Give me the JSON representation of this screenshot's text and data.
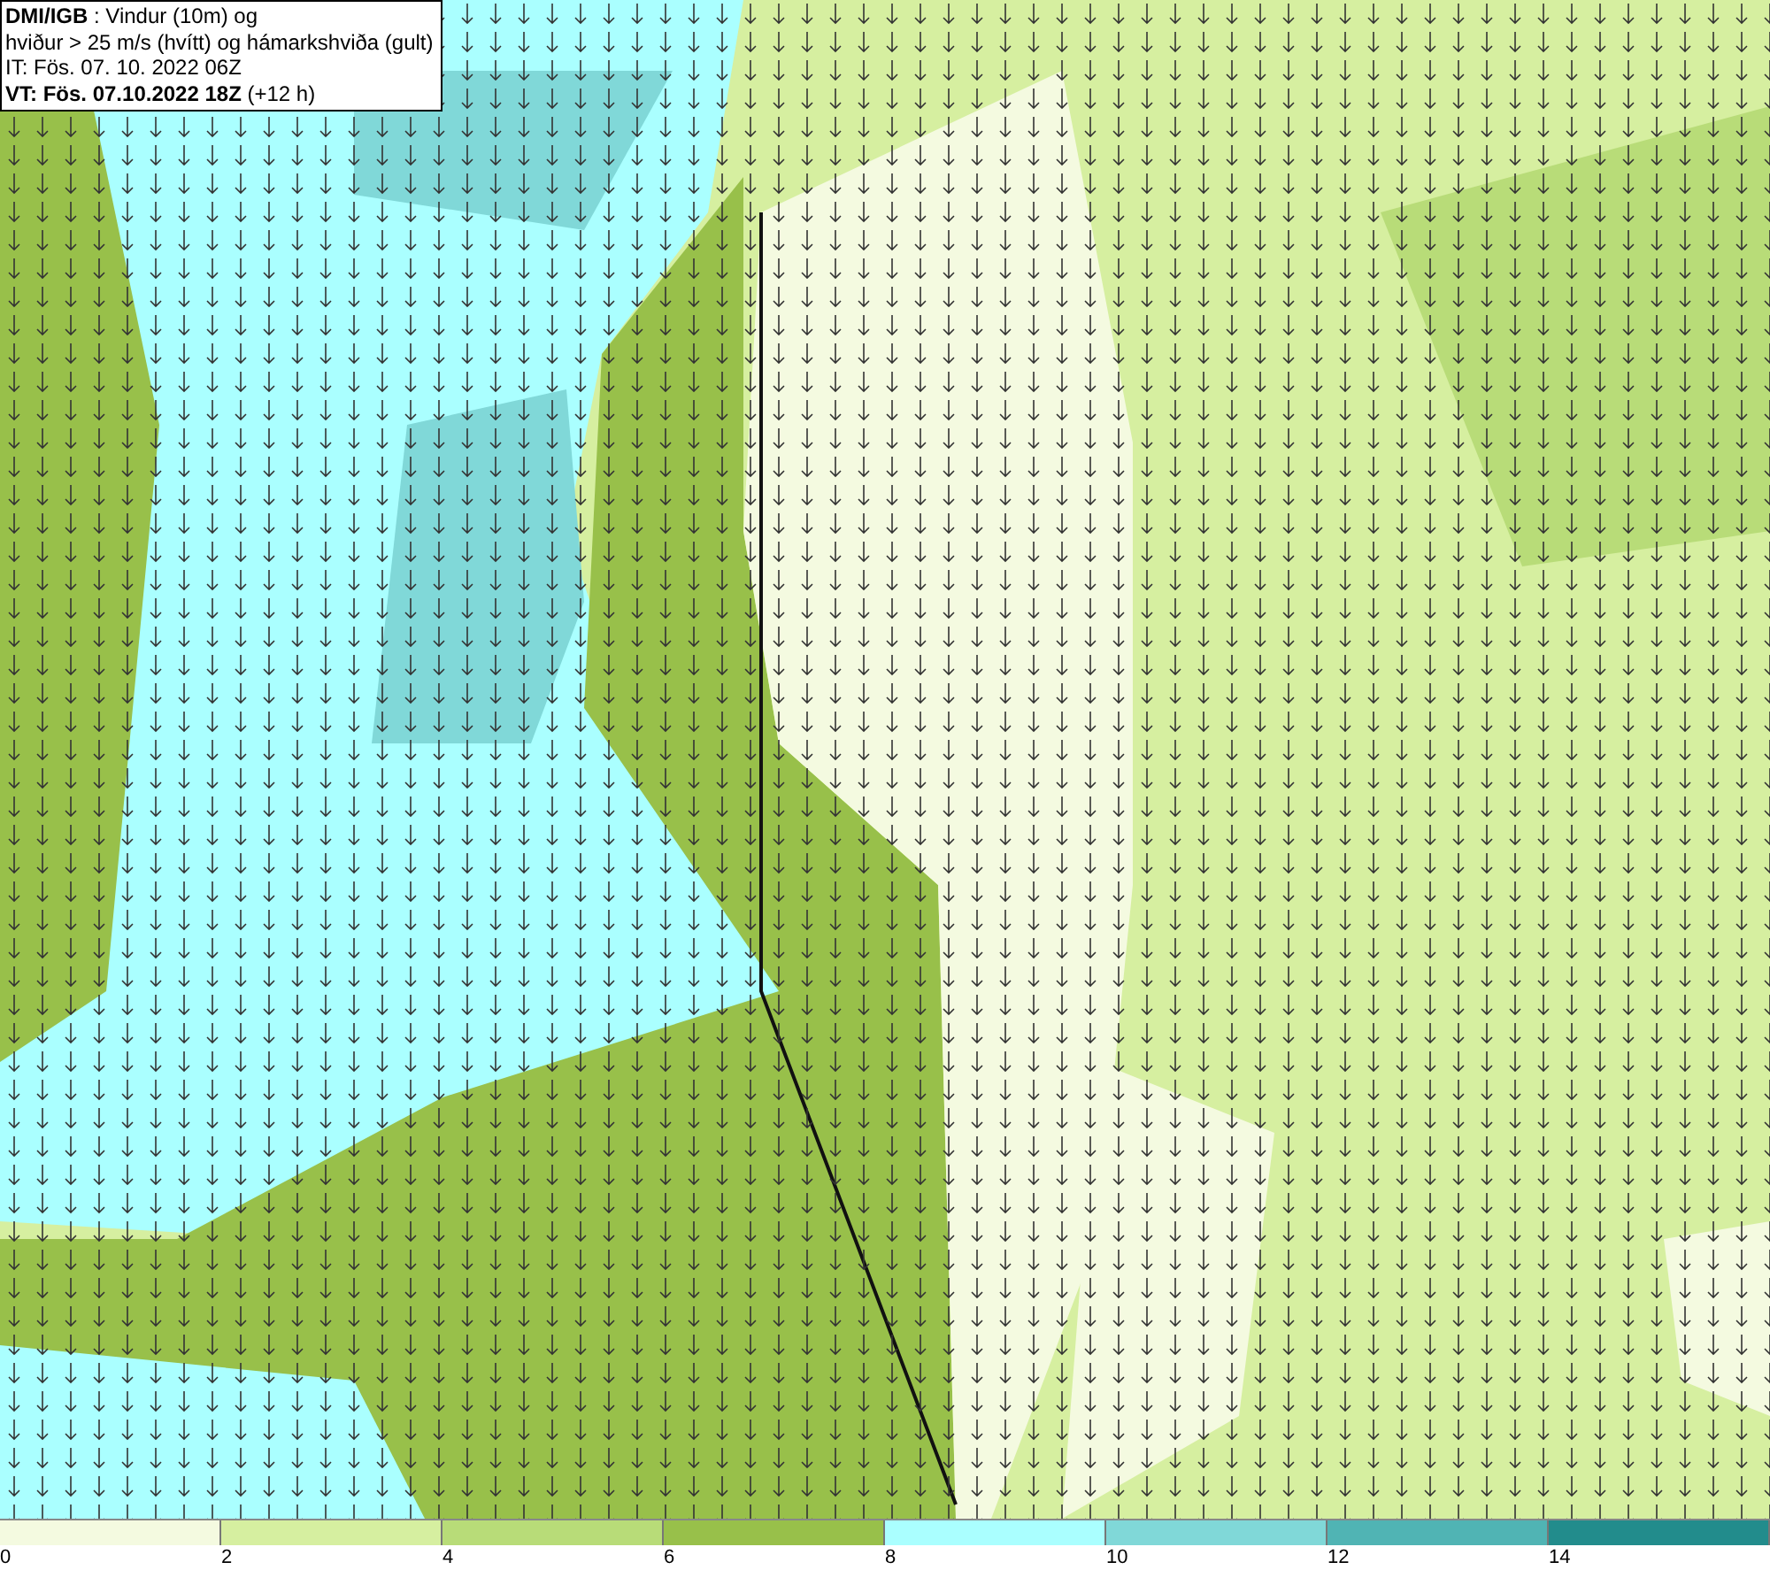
{
  "title_box": {
    "lines": [
      "**DMI/IGB** : Vindur (10m) og",
      "hviður > 25 m/s (hvítt) og hámarkshviða (gult)",
      "IT: Fös. 07. 10. 2022 06Z",
      "**VT: Fös. 07.10.2022 18Z** (+12 h)"
    ]
  },
  "legend": {
    "bins": [
      {
        "color": "#f4fae0"
      },
      {
        "color": "#d6efa0"
      },
      {
        "color": "#b8dc78"
      },
      {
        "color": "#98c04a"
      },
      {
        "color": "#aaffff"
      },
      {
        "color": "#80d8d8"
      },
      {
        "color": "#50b4b4"
      },
      {
        "color": "#228c8c"
      }
    ],
    "ticks": [
      "0",
      "2",
      "4",
      "6",
      "8",
      "10",
      "12",
      "14"
    ]
  }
}
